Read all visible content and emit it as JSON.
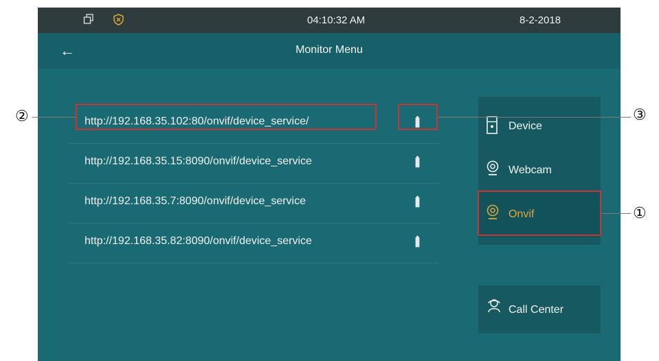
{
  "status": {
    "time": "04:10:32   AM",
    "date": "8-2-2018",
    "icons": [
      "window-icon",
      "shield-icon"
    ]
  },
  "header": {
    "title": "Monitor Menu",
    "back_icon": "back-arrow-icon",
    "back_glyph": "←"
  },
  "urls": [
    "http://192.168.35.102:80/onvif/device_service/",
    "http://192.168.35.15:8090/onvif/device_service",
    "http://192.168.35.7:8090/onvif/device_service",
    "http://192.168.35.82:8090/onvif/device_service"
  ],
  "sidebar": {
    "items": [
      {
        "label": "Device",
        "icon": "device-icon"
      },
      {
        "label": "Webcam",
        "icon": "webcam-icon"
      },
      {
        "label": "Onvif",
        "icon": "onvif-camera-icon",
        "active": true
      }
    ],
    "call_center": {
      "label": "Call Center",
      "icon": "headset-icon"
    }
  },
  "callouts": [
    "①",
    "②",
    "③"
  ],
  "colors": {
    "accent": "#e0a73a",
    "annotation": "#cc3333",
    "background": "#196a72"
  }
}
